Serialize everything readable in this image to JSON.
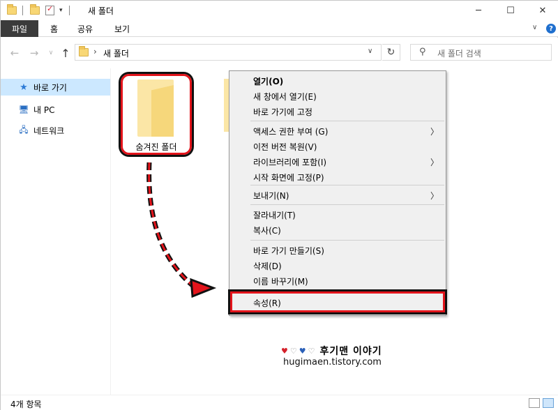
{
  "window": {
    "title": "새 폴더",
    "minimize": "─",
    "maximize": "☐",
    "close": "✕"
  },
  "ribbon": {
    "file": "파일",
    "tabs": [
      "홈",
      "공유",
      "보기"
    ],
    "collapse": "∨",
    "help": "?"
  },
  "address": {
    "chevron": "›",
    "path": "새 폴더",
    "dropdown": "∨",
    "refresh": "↻"
  },
  "search": {
    "placeholder": "새 폴더 검색"
  },
  "nav_buttons": {
    "back": "←",
    "forward": "→",
    "recent": "∨",
    "up": "↑"
  },
  "sidebar": {
    "items": [
      {
        "label": "바로 가기",
        "icon": "star-icon",
        "glyph": "★"
      },
      {
        "label": "내 PC",
        "icon": "pc-icon",
        "glyph": "🖥"
      },
      {
        "label": "네트워크",
        "icon": "network-icon",
        "glyph": "🖧"
      }
    ]
  },
  "content": {
    "folder_label": "숨겨진 폴더"
  },
  "context_menu": {
    "items": [
      {
        "label": "열기(O)",
        "bold": true
      },
      {
        "label": "새 창에서 열기(E)"
      },
      {
        "label": "바로 가기에 고정"
      },
      {
        "label": "액세스 권한 부여 (G)",
        "submenu": true
      },
      {
        "label": "이전 버전 복원(V)"
      },
      {
        "label": "라이브러리에 포함(I)",
        "submenu": true
      },
      {
        "label": "시작 화면에 고정(P)"
      },
      {
        "label": "보내기(N)",
        "submenu": true
      },
      {
        "label": "잘라내기(T)"
      },
      {
        "label": "복사(C)"
      },
      {
        "label": "바로 가기 만들기(S)"
      },
      {
        "label": "삭제(D)"
      },
      {
        "label": "이름 바꾸기(M)"
      },
      {
        "label": "속성(R)"
      }
    ],
    "submenu_glyph": "〉"
  },
  "watermark": {
    "hearts": [
      "♥",
      "♡",
      "♥",
      "♡"
    ],
    "title": "후기맨 이야기",
    "url": "hugimaen.tistory.com"
  },
  "status": {
    "count": "4개 항목"
  },
  "colors": {
    "annotation_red": "#e3141b",
    "selected_nav": "#cce8ff",
    "file_tab": "#3b3b3b",
    "menu_bg": "#f0f0f0"
  }
}
